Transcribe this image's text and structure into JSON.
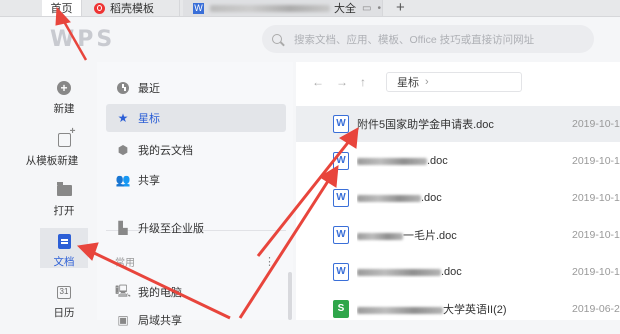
{
  "tabs": {
    "home": "首页",
    "daoke": "稻壳模板",
    "doc_suffix": "大全",
    "new_tab": "+"
  },
  "header": {
    "logo": "WPS",
    "search_placeholder": "搜索文档、应用、模板、Office 技巧或直接访问网址"
  },
  "rail": {
    "new": "新建",
    "template_new": "从模板新建",
    "open": "打开",
    "docs": "文档",
    "calendar": "日历"
  },
  "nav": {
    "recent": "最近",
    "starred": "星标",
    "cloud": "我的云文档",
    "share": "共享",
    "upgrade": "升级至企业版",
    "section": "常用",
    "my_computer": "我的电脑",
    "more": "局域共享"
  },
  "main": {
    "breadcrumb": "星标",
    "files": [
      {
        "name": "附件5国家助学金申请表.doc",
        "date": "2019-10-1",
        "icon": "W",
        "blur": 0
      },
      {
        "name": ".doc",
        "date": "2019-10-1",
        "icon": "W",
        "blur": 70
      },
      {
        "name": ".doc",
        "date": "2019-10-1",
        "icon": "W",
        "blur": 64
      },
      {
        "name": "一毛片.doc",
        "date": "2019-10-1",
        "icon": "W",
        "blur": 46
      },
      {
        "name": ".doc",
        "date": "2019-10-1",
        "icon": "W",
        "blur": 84
      },
      {
        "name": "大学英语II(2)",
        "date": "2019-06-2",
        "icon": "S",
        "blur": 86
      }
    ]
  },
  "colors": {
    "accent": "#2c5fd6",
    "annotation": "#e8453c"
  }
}
